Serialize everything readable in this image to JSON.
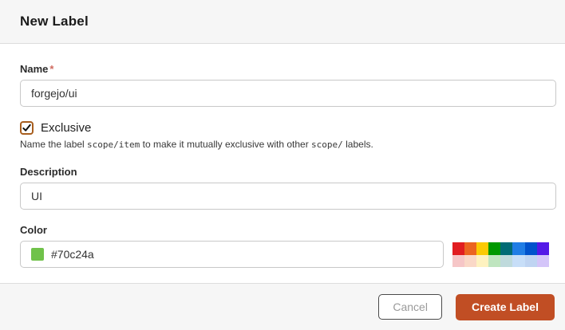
{
  "dialog": {
    "title": "New Label",
    "fields": {
      "name": {
        "label": "Name",
        "required_marker": "*",
        "value": "forgejo/ui"
      },
      "exclusive": {
        "label": "Exclusive",
        "checked": true,
        "help_prefix": "Name the label ",
        "help_code1": "scope/item",
        "help_middle": " to make it mutually exclusive with other ",
        "help_code2": "scope/",
        "help_suffix": " labels."
      },
      "description": {
        "label": "Description",
        "value": "UI"
      },
      "color": {
        "label": "Color",
        "value": "#70c24a",
        "swatch_color": "#70c24a"
      }
    },
    "palette": {
      "row1": [
        "#e11d21",
        "#eb6420",
        "#fbca04",
        "#009800",
        "#006b75",
        "#207de5",
        "#0052cc",
        "#5319e7"
      ],
      "row2": [
        "#f6c6c7",
        "#fad8c7",
        "#fef2c0",
        "#bfe5bf",
        "#bfdadc",
        "#c7def8",
        "#bfd4f2",
        "#d4c5f9"
      ]
    },
    "buttons": {
      "cancel": "Cancel",
      "create": "Create Label"
    },
    "colors": {
      "primary_button": "#c14e24",
      "checkbox_border": "#a85e1e",
      "required_asterisk": "#d06a5f"
    }
  }
}
